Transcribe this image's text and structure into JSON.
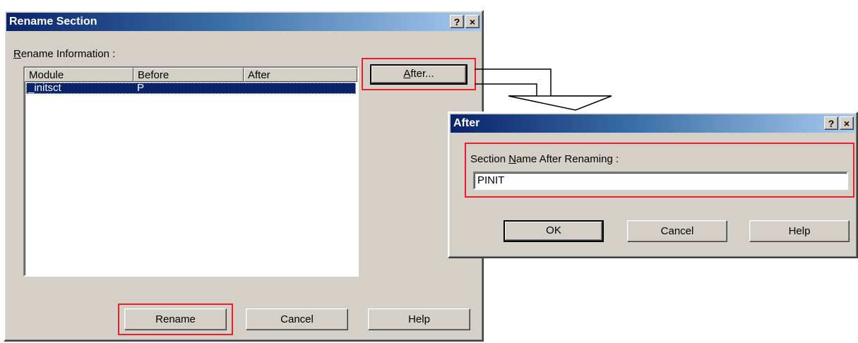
{
  "rename_dialog": {
    "title": "Rename Section",
    "help_glyph": "?",
    "close_glyph": "×",
    "info_label_prefix": "",
    "info_label_accel": "R",
    "info_label_rest": "ename Information :",
    "columns": [
      "Module",
      "Before",
      "After"
    ],
    "rows": [
      {
        "module": "_initsct",
        "before": "P",
        "after": ""
      }
    ],
    "after_button_accel": "A",
    "after_button_rest": "fter...",
    "rename_label": "Rename",
    "cancel_label": "Cancel",
    "help_label": "Help"
  },
  "after_dialog": {
    "title": "After",
    "help_glyph": "?",
    "close_glyph": "×",
    "label_prefix": "Section ",
    "label_accel": "N",
    "label_rest": "ame After Renaming :",
    "value": "PINIT",
    "ok_label": "OK",
    "cancel_label": "Cancel",
    "help_label": "Help"
  },
  "colors": {
    "highlight_box": "#e8202a",
    "title_gradient_start": "#0a246a",
    "dialog_face": "#d4d0c8",
    "selection": "#0a246a"
  }
}
